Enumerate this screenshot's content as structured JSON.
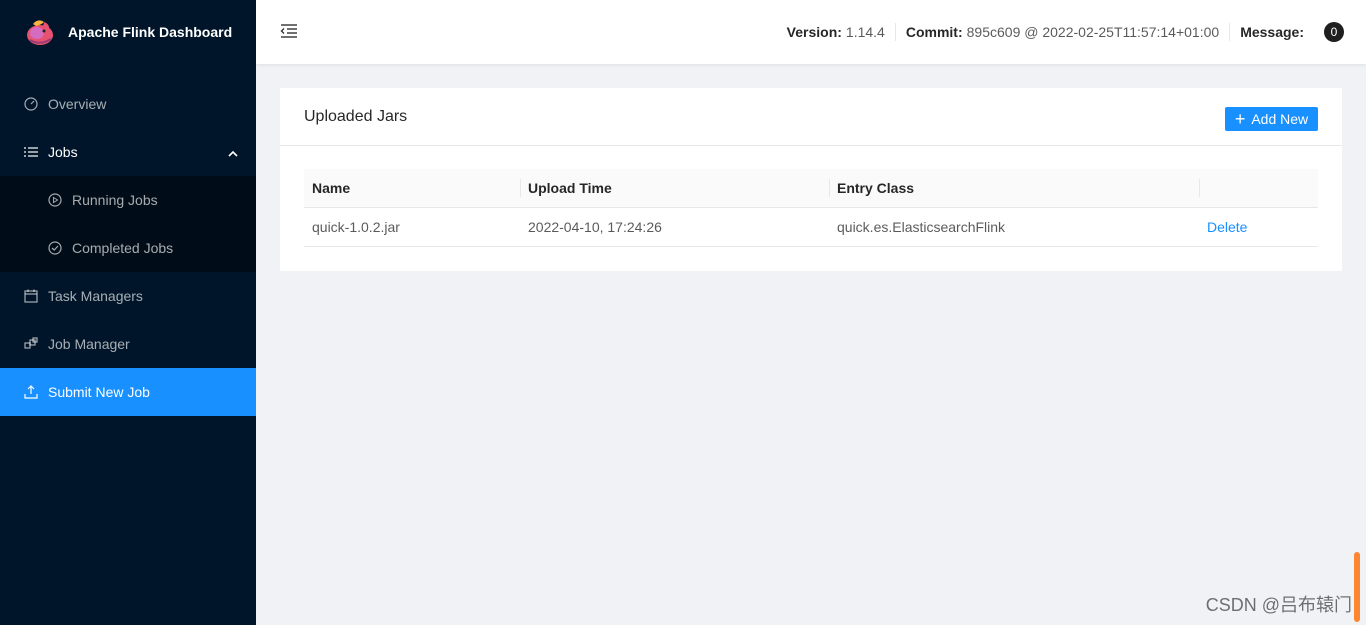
{
  "app": {
    "title": "Apache Flink Dashboard"
  },
  "sidebar": {
    "items": [
      {
        "label": "Overview",
        "icon": "dashboard-icon"
      },
      {
        "label": "Jobs",
        "icon": "list-icon"
      },
      {
        "label": "Running Jobs",
        "icon": "play-circle-icon"
      },
      {
        "label": "Completed Jobs",
        "icon": "check-circle-icon"
      },
      {
        "label": "Task Managers",
        "icon": "schedule-icon"
      },
      {
        "label": "Job Manager",
        "icon": "build-icon"
      },
      {
        "label": "Submit New Job",
        "icon": "upload-icon"
      }
    ]
  },
  "header": {
    "version_label": "Version:",
    "version_value": "1.14.4",
    "commit_label": "Commit:",
    "commit_value": "895c609 @ 2022-02-25T11:57:14+01:00",
    "message_label": "Message:",
    "message_count": "0"
  },
  "card": {
    "title": "Uploaded Jars",
    "add_label": "Add New",
    "columns": [
      "Name",
      "Upload Time",
      "Entry Class",
      ""
    ],
    "rows": [
      {
        "name": "quick-1.0.2.jar",
        "upload_time": "2022-04-10, 17:24:26",
        "entry_class": "quick.es.ElasticsearchFlink",
        "action": "Delete"
      }
    ]
  },
  "watermark": "CSDN @吕布辕门",
  "colors": {
    "sider": "#001529",
    "accent": "#1890ff"
  }
}
